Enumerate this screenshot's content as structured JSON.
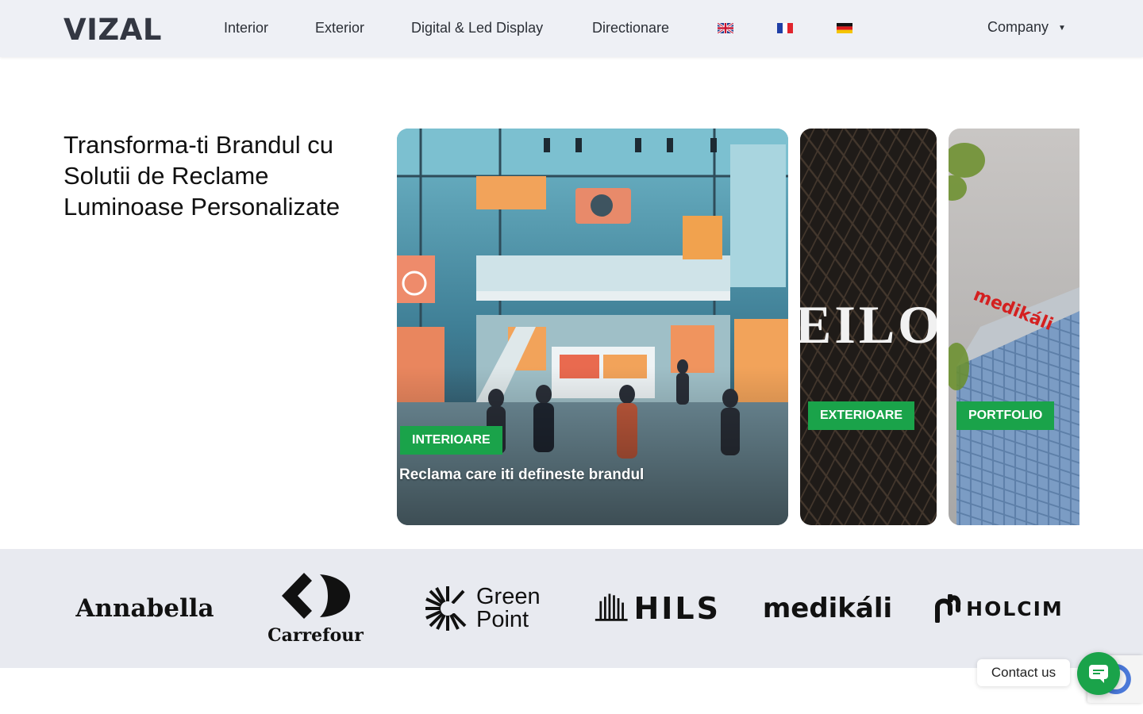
{
  "header": {
    "logo": "VIZAL",
    "nav": [
      {
        "label": "Interior"
      },
      {
        "label": "Exterior"
      },
      {
        "label": "Digital & Led Display"
      },
      {
        "label": "Directionare"
      }
    ],
    "flags": [
      "uk-flag-icon",
      "fr-flag-icon",
      "de-flag-icon"
    ],
    "company": "Company"
  },
  "hero": {
    "title": "Transforma-ti Brandul cu Solutii de Reclame Luminoase Personalizate",
    "cards": [
      {
        "tag": "INTERIOARE",
        "caption": "Reclama care iti defineste brandul"
      },
      {
        "tag": "EXTERIOARE",
        "sign_text": "EILO"
      },
      {
        "tag": "PORTFOLIO",
        "sign_text": "medikáli"
      }
    ]
  },
  "brands": [
    "Annabella",
    "Carrefour",
    "Green Point",
    "HILS",
    "medikáli",
    "HOLCIM"
  ],
  "contact": {
    "label": "Contact us"
  },
  "colors": {
    "accent": "#1aa34a",
    "header_bg": "#eef0f5",
    "strip_bg": "#e8eaf0"
  }
}
